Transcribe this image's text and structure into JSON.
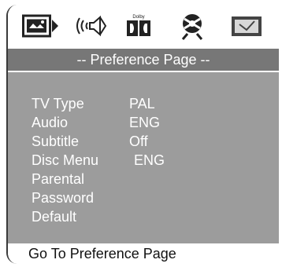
{
  "icons": [
    {
      "name": "general-setup-icon"
    },
    {
      "name": "audio-setup-icon"
    },
    {
      "name": "dolby-setup-icon",
      "text": "Dolby"
    },
    {
      "name": "video-setup-icon"
    },
    {
      "name": "preference-setup-icon"
    }
  ],
  "title": "-- Preference Page --",
  "menu": {
    "items": [
      {
        "label": "TV Type",
        "value": "PAL"
      },
      {
        "label": "Audio",
        "value": "ENG"
      },
      {
        "label": "Subtitle",
        "value": "Off"
      },
      {
        "label": "Disc Menu",
        "value": "ENG"
      },
      {
        "label": "Parental",
        "value": ""
      },
      {
        "label": "Password",
        "value": ""
      },
      {
        "label": "Default",
        "value": ""
      }
    ]
  },
  "status": "Go To Preference Page",
  "colors": {
    "title_bar": "#777777",
    "menu_panel": "#9c9c9c",
    "text_on_gray": "#ffffff"
  }
}
